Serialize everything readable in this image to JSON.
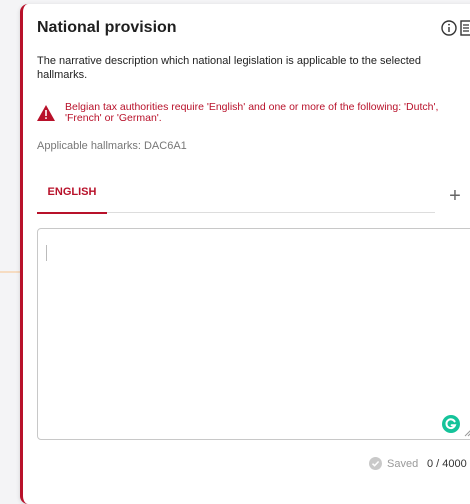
{
  "card": {
    "title": "National provision",
    "description": "The narrative description which national legislation is applicable to the selected hallmarks.",
    "warning": "Belgian tax authorities require 'English' and one or more of the following: 'Dutch', 'French' or 'German'.",
    "hallmarks": "Applicable hallmarks: DAC6A1"
  },
  "tabs": [
    {
      "label": "ENGLISH",
      "active": true
    }
  ],
  "add_tab_label": "+",
  "editor": {
    "value": ""
  },
  "footer": {
    "saved_label": "Saved",
    "counter": "0 / 4000"
  },
  "icons": {
    "info": "info-icon",
    "document": "document-icon",
    "warning": "warning-icon",
    "grammarly": "grammarly-icon",
    "saved": "check-circle-icon"
  },
  "colors": {
    "accent": "#b8112a",
    "grammarly": "#15c39a",
    "muted": "#777777"
  }
}
